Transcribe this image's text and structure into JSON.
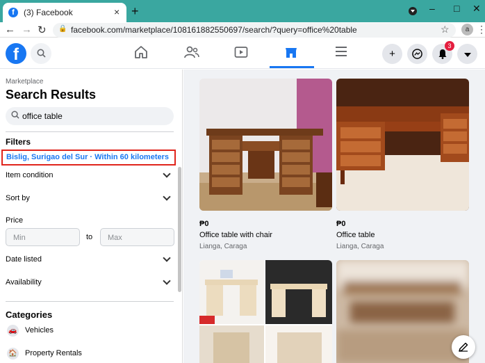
{
  "browser": {
    "tab_title": "(3) Facebook",
    "tab_favicon": "f",
    "close_icon": "×",
    "new_tab_icon": "+",
    "url": "facebook.com/marketplace/108161882550697/search/?query=office%20table",
    "account_initial": "a",
    "window_controls": [
      "–",
      "□",
      "✕"
    ]
  },
  "header": {
    "logo": "f",
    "notification_count": "3",
    "nav_icons": [
      "home-icon",
      "friends-icon",
      "watch-icon",
      "marketplace-icon",
      "menu-icon"
    ],
    "action_icons": [
      "plus-icon",
      "messenger-icon",
      "bell-icon",
      "account-caret-icon"
    ]
  },
  "sidebar": {
    "breadcrumb": "Marketplace",
    "title": "Search Results",
    "search_value": "office table",
    "filters_label": "Filters",
    "location_filter": "Bislig, Surigao del Sur · Within 60 kilometers",
    "filter_rows": {
      "item_condition": "Item condition",
      "sort_by": "Sort by",
      "date_listed": "Date listed",
      "availability": "Availability"
    },
    "price": {
      "label": "Price",
      "min_placeholder": "Min",
      "to": "to",
      "max_placeholder": "Max"
    },
    "categories_label": "Categories",
    "categories": [
      {
        "label": "Vehicles",
        "icon": "car-icon"
      },
      {
        "label": "Property Rentals",
        "icon": "house-icon"
      }
    ]
  },
  "listings": [
    {
      "price": "₱0",
      "title": "Office table with chair",
      "location": "Lianga, Caraga"
    },
    {
      "price": "₱0",
      "title": "Office table",
      "location": "Lianga, Caraga"
    }
  ],
  "colors": {
    "brand": "#1877f2",
    "tabbar": "#3aa7a0",
    "highlight_border": "#e0241c",
    "badge": "#e41e3f"
  }
}
